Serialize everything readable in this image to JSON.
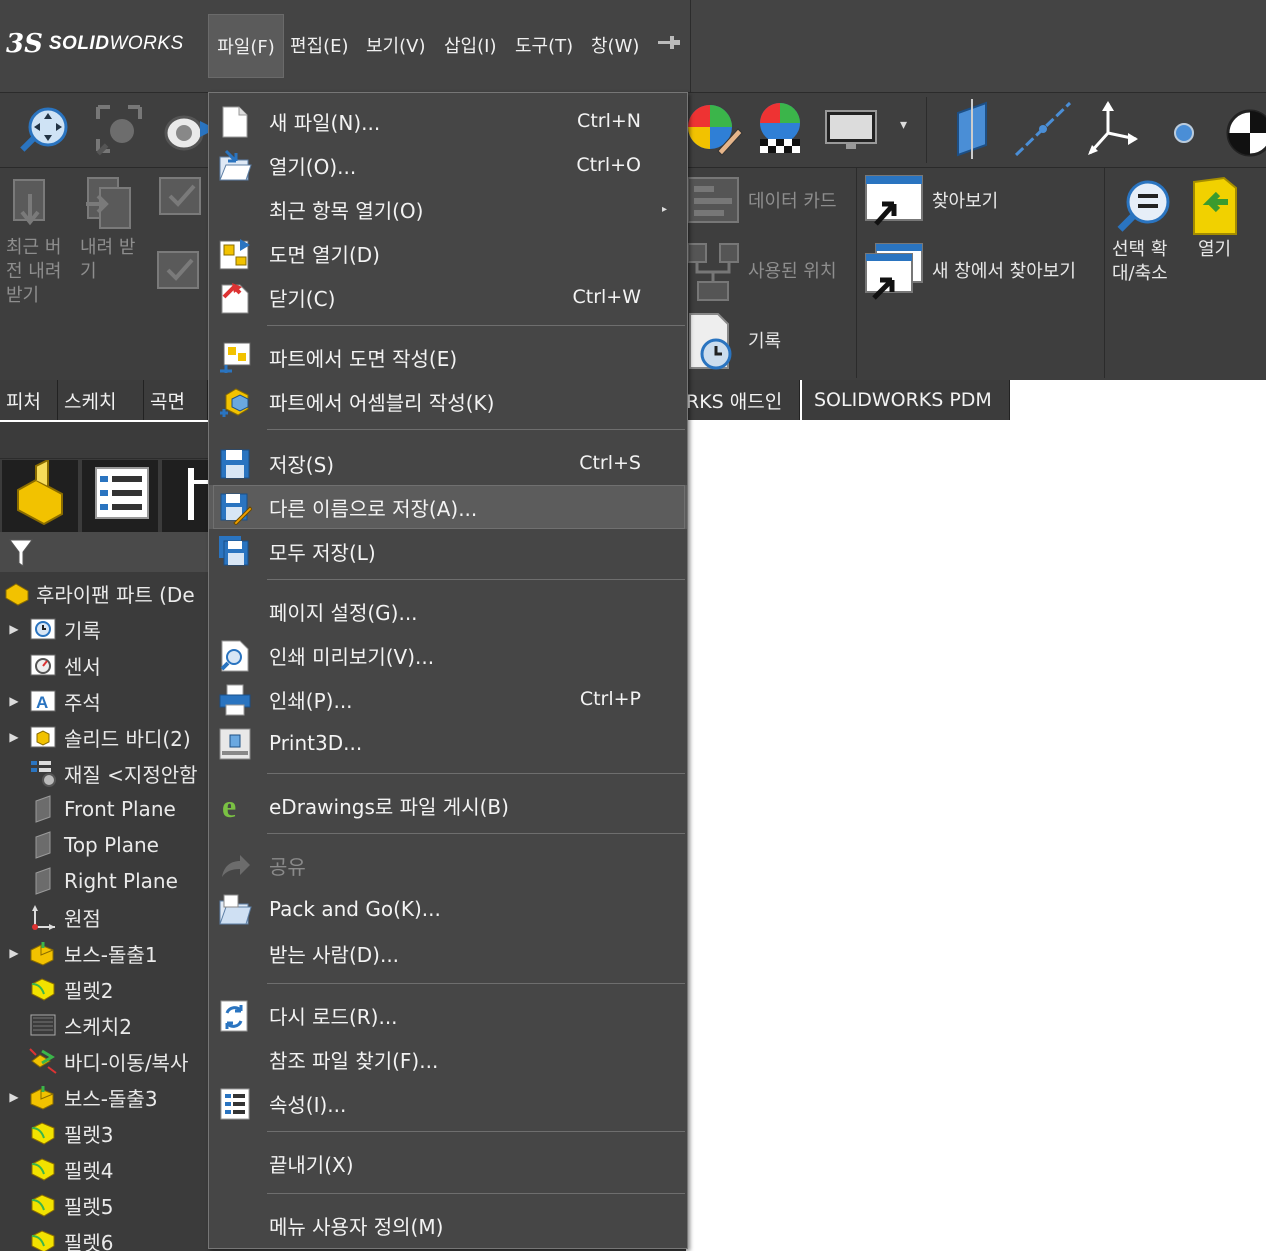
{
  "app": {
    "brand_ds": "3S",
    "brand_name_bold": "SOLID",
    "brand_name_rest": "WORKS"
  },
  "menubar": {
    "items": [
      {
        "label": "파일(F)"
      },
      {
        "label": "편집(E)"
      },
      {
        "label": "보기(V)"
      },
      {
        "label": "삽입(I)"
      },
      {
        "label": "도구(T)"
      },
      {
        "label": "창(W)"
      }
    ],
    "pin_icon": "pin-icon"
  },
  "ribbon": {
    "left_buttons": [
      "최근 버전 내려받기",
      "내려 받기"
    ],
    "left_label_1": "최근 버\n전 내려\n받기",
    "left_label_2": "내려 받\n기",
    "data_card": "데이터 카드",
    "used_location": "사용된 위치",
    "history": "기록",
    "browse": "찾아보기",
    "browse_new_window": "새 창에서 찾아보기",
    "select_zoom": "선택 확\n대/축소",
    "open": "열기"
  },
  "tabs": [
    "피처",
    "스케치",
    "곡면",
    "RKS 애드인",
    "SOLIDWORKS PDM"
  ],
  "tree": {
    "root": "후라이팬 파트 (De",
    "items": [
      {
        "label": "기록",
        "icon": "history-icon",
        "expandable": true
      },
      {
        "label": "센서",
        "icon": "sensor-icon",
        "expandable": false
      },
      {
        "label": "주석",
        "icon": "annotation-icon",
        "expandable": true
      },
      {
        "label": "솔리드 바디(2)",
        "icon": "solid-body-icon",
        "expandable": true
      },
      {
        "label": "재질 <지정안함",
        "icon": "material-icon",
        "expandable": false
      },
      {
        "label": "Front Plane",
        "icon": "plane-icon",
        "expandable": false
      },
      {
        "label": "Top Plane",
        "icon": "plane-icon",
        "expandable": false
      },
      {
        "label": "Right Plane",
        "icon": "plane-icon",
        "expandable": false
      },
      {
        "label": "원점",
        "icon": "origin-icon",
        "expandable": false
      },
      {
        "label": "보스-돌출1",
        "icon": "boss-extrude-icon",
        "expandable": true
      },
      {
        "label": "필렛2",
        "icon": "fillet-icon",
        "expandable": false
      },
      {
        "label": "스케치2",
        "icon": "sketch-icon",
        "expandable": false
      },
      {
        "label": "바디-이동/복사",
        "icon": "move-body-icon",
        "expandable": false
      },
      {
        "label": "보스-돌출3",
        "icon": "boss-extrude-icon",
        "expandable": true
      },
      {
        "label": "필렛3",
        "icon": "fillet-icon",
        "expandable": false
      },
      {
        "label": "필렛4",
        "icon": "fillet-icon",
        "expandable": false
      },
      {
        "label": "필렛5",
        "icon": "fillet-icon",
        "expandable": false
      },
      {
        "label": "필렛6",
        "icon": "fillet-icon",
        "expandable": false
      }
    ]
  },
  "file_menu": {
    "items": [
      {
        "label": "새 파일(N)...",
        "shortcut": "Ctrl+N",
        "icon": "new-file-icon"
      },
      {
        "label": "열기(O)...",
        "shortcut": "Ctrl+O",
        "icon": "open-icon"
      },
      {
        "label": "최근 항목 열기(O)",
        "shortcut": "",
        "icon": "",
        "submenu": true
      },
      {
        "label": "도면 열기(D)",
        "shortcut": "",
        "icon": "open-drawing-icon"
      },
      {
        "label": "닫기(C)",
        "shortcut": "Ctrl+W",
        "icon": "close-icon"
      },
      {
        "label": "파트에서 도면 작성(E)",
        "shortcut": "",
        "icon": "make-drawing-icon"
      },
      {
        "label": "파트에서 어셈블리 작성(K)",
        "shortcut": "",
        "icon": "make-assembly-icon"
      },
      {
        "label": "저장(S)",
        "shortcut": "Ctrl+S",
        "icon": "save-icon"
      },
      {
        "label": "다른 이름으로 저장(A)...",
        "shortcut": "",
        "icon": "save-as-icon",
        "highlighted": true
      },
      {
        "label": "모두 저장(L)",
        "shortcut": "",
        "icon": "save-all-icon"
      },
      {
        "label": "페이지 설정(G)...",
        "shortcut": "",
        "icon": ""
      },
      {
        "label": "인쇄 미리보기(V)...",
        "shortcut": "",
        "icon": "print-preview-icon"
      },
      {
        "label": "인쇄(P)...",
        "shortcut": "Ctrl+P",
        "icon": "print-icon"
      },
      {
        "label": "Print3D...",
        "shortcut": "",
        "icon": "print3d-icon"
      },
      {
        "label": "eDrawings로 파일 게시(B)",
        "shortcut": "",
        "icon": "edrawings-icon"
      },
      {
        "label": "공유",
        "shortcut": "",
        "icon": "share-icon",
        "disabled": true
      },
      {
        "label": "Pack and Go(K)...",
        "shortcut": "",
        "icon": "pack-and-go-icon"
      },
      {
        "label": "받는 사람(D)...",
        "shortcut": "",
        "icon": ""
      },
      {
        "label": "다시 로드(R)...",
        "shortcut": "",
        "icon": "reload-icon"
      },
      {
        "label": "참조 파일 찾기(F)...",
        "shortcut": "",
        "icon": ""
      },
      {
        "label": "속성(I)...",
        "shortcut": "",
        "icon": "properties-icon"
      },
      {
        "label": "끝내기(X)",
        "shortcut": "",
        "icon": ""
      },
      {
        "label": "메뉴 사용자 정의(M)",
        "shortcut": "",
        "icon": ""
      }
    ]
  },
  "colors": {
    "menu_bg": "#464646",
    "highlight_bg": "#5c5c5c",
    "app_bg": "#3a3a3a",
    "canvas": "#ffffff"
  }
}
